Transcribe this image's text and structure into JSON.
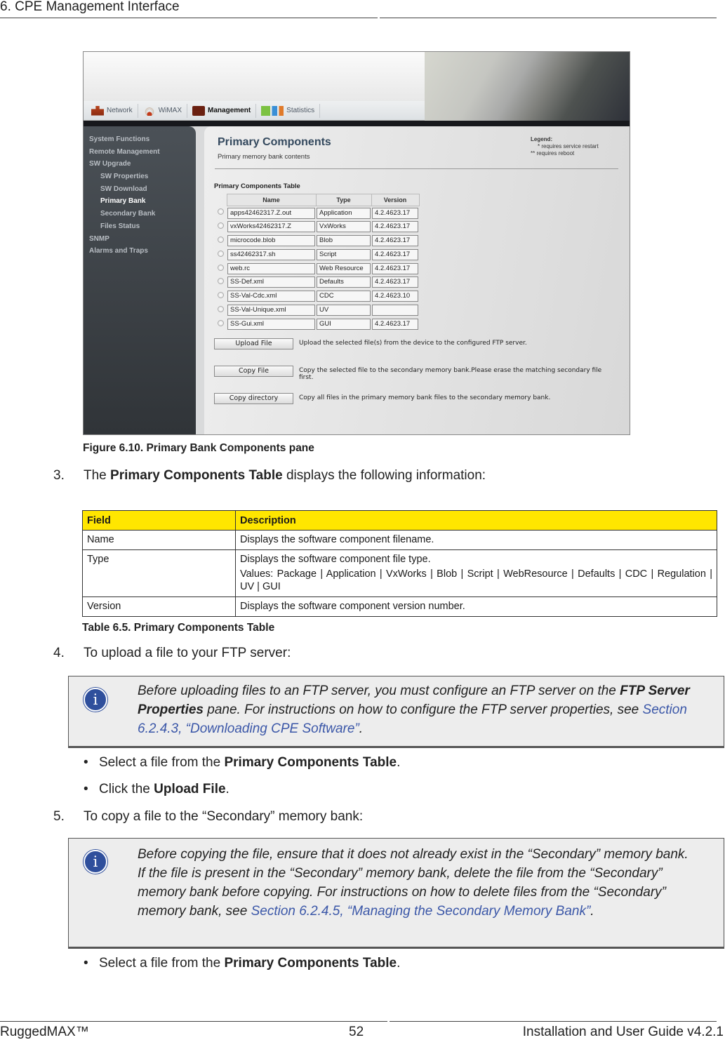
{
  "page_header": {
    "title": "6. CPE Management Interface"
  },
  "screenshot": {
    "nav_tabs": [
      {
        "label": "Network",
        "icon": "network-icon",
        "active": false
      },
      {
        "label": "WiMAX",
        "icon": "wimax-icon",
        "active": false
      },
      {
        "label": "Management",
        "icon": "management-icon",
        "active": true
      },
      {
        "label": "Statistics",
        "icon": "statistics-icon",
        "active": false
      }
    ],
    "sidebar": [
      {
        "label": "System Functions",
        "sub": false,
        "active": false
      },
      {
        "label": "Remote Management",
        "sub": false,
        "active": false
      },
      {
        "label": "SW Upgrade",
        "sub": false,
        "active": false
      },
      {
        "label": "SW Properties",
        "sub": true,
        "active": false
      },
      {
        "label": "SW Download",
        "sub": true,
        "active": false
      },
      {
        "label": "Primary Bank",
        "sub": true,
        "active": true
      },
      {
        "label": "Secondary Bank",
        "sub": true,
        "active": false
      },
      {
        "label": "Files Status",
        "sub": true,
        "active": false
      },
      {
        "label": "SNMP",
        "sub": false,
        "active": false
      },
      {
        "label": "Alarms and Traps",
        "sub": false,
        "active": false
      }
    ],
    "pane_title": "Primary Components",
    "pane_subtitle": "Primary memory bank contents",
    "legend": {
      "title": "Legend:",
      "line1": "* requires service restart",
      "line2": "** requires reboot"
    },
    "table_caption": "Primary Components Table",
    "table_headers": [
      "Name",
      "Type",
      "Version"
    ],
    "rows": [
      {
        "name": "apps42462317.Z.out",
        "type": "Application",
        "version": "4.2.4623.17"
      },
      {
        "name": "vxWorks42462317.Z",
        "type": "VxWorks",
        "version": "4.2.4623.17"
      },
      {
        "name": "microcode.blob",
        "type": "Blob",
        "version": "4.2.4623.17"
      },
      {
        "name": "ss42462317.sh",
        "type": "Script",
        "version": "4.2.4623.17"
      },
      {
        "name": "web.rc",
        "type": "Web Resource",
        "version": "4.2.4623.17"
      },
      {
        "name": "SS-Def.xml",
        "type": "Defaults",
        "version": "4.2.4623.17"
      },
      {
        "name": "SS-Val-Cdc.xml",
        "type": "CDC",
        "version": "4.2.4623.10"
      },
      {
        "name": "SS-Val-Unique.xml",
        "type": "UV",
        "version": ""
      },
      {
        "name": "SS-Gui.xml",
        "type": "GUI",
        "version": "4.2.4623.17"
      }
    ],
    "actions": [
      {
        "label": "Upload File",
        "description": "Upload the selected file(s) from the device to the configured FTP server."
      },
      {
        "label": "Copy File",
        "description": "Copy the selected file to the secondary memory bank.Please erase the matching secondary file first."
      },
      {
        "label": "Copy directory",
        "description": "Copy all files in the primary memory bank files to the secondary memory bank."
      }
    ]
  },
  "figure_caption": "Figure 6.10. Primary Bank Components pane",
  "step3": {
    "num": "3.",
    "pre": "The ",
    "bold": "Primary Components Table",
    "post": " displays the following information:"
  },
  "info_table": {
    "headers": [
      "Field",
      "Description"
    ],
    "rows": [
      {
        "field": "Name",
        "desc": "Displays the software component filename.",
        "desc2": ""
      },
      {
        "field": "Type",
        "desc": "Displays the software component file type.",
        "desc2": "Values: Package | Application | VxWorks | Blob | Script | WebResource | Defaults | CDC | Regulation | UV | GUI"
      },
      {
        "field": "Version",
        "desc": "Displays the software component version number.",
        "desc2": ""
      }
    ],
    "caption": "Table 6.5. Primary Components Table"
  },
  "step4": {
    "num": "4.",
    "text": "To upload a file to your FTP server:"
  },
  "note1": {
    "pre": "Before uploading files to an FTP server, you must configure an FTP server on the ",
    "bold": "FTP Server Properties",
    "mid": " pane. For instructions on how to configure the FTP server properties, see ",
    "link": "Section 6.2.4.3, “Downloading CPE Software”",
    "post": "."
  },
  "bullets_a": [
    {
      "pre": "Select a file from the ",
      "bold": "Primary Components Table",
      "post": "."
    },
    {
      "pre": "Click the ",
      "bold": "Upload File",
      "post": "."
    }
  ],
  "step5": {
    "num": "5.",
    "text": "To copy a file to the “Secondary” memory bank:"
  },
  "note2": {
    "pre": "Before copying the file, ensure that it does not already exist in the “Secondary” memory bank. If the file is present in the “Secondary” memory bank, delete the file from the “Secondary” memory bank before copying. For instructions on how to delete files from the “Secondary” memory bank, see ",
    "link": "Section 6.2.4.5, “Managing the Secondary Memory Bank”",
    "post": "."
  },
  "bullets_b": [
    {
      "pre": "Select a file from the ",
      "bold": "Primary Components Table",
      "post": "."
    }
  ],
  "page_footer": {
    "left": "RuggedMAX™",
    "center": "52",
    "right": "Installation and User Guide v4.2.1"
  }
}
